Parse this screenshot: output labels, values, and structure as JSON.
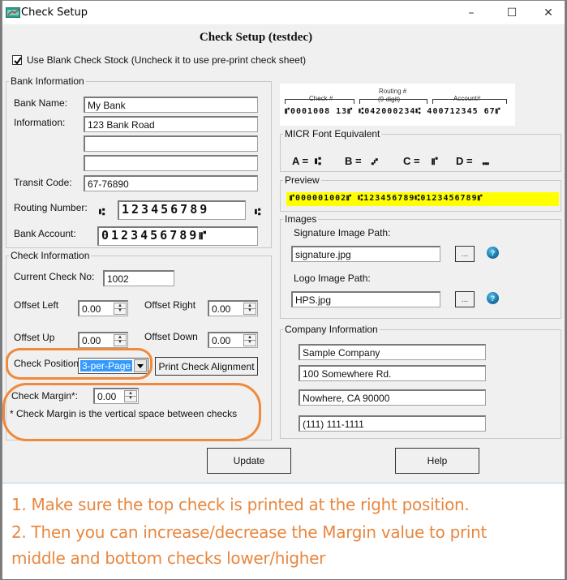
{
  "window": {
    "title": "Check Setup",
    "controls": {
      "minimize": "–",
      "maximize": "☐",
      "close": "✕"
    }
  },
  "heading": "Check Setup (testdec)",
  "blank_check_stock": {
    "label": "Use Blank Check Stock (Uncheck it to use pre-print check sheet)",
    "checked": true
  },
  "bank_information": {
    "legend": "Bank Information",
    "bank_name_label": "Bank Name:",
    "bank_name": "My Bank",
    "information_label": "Information:",
    "information_line1": "123 Bank Road",
    "information_line2": "",
    "information_line3": "",
    "transit_code_label": "Transit Code:",
    "transit_code": "67-76890",
    "routing_number_label": "Routing Number:",
    "routing_number": "123456789",
    "routing_symbol": "⑆",
    "bank_account_label": "Bank Account:",
    "bank_account": "0123456789⑈"
  },
  "check_information": {
    "legend": "Check Information",
    "current_check_label": "Current Check No:",
    "current_check_no": "1002",
    "offset_left_label": "Offset Left",
    "offset_left": "0.00",
    "offset_right_label": "Offset Right",
    "offset_right": "0.00",
    "offset_up_label": "Offset Up",
    "offset_up": "0.00",
    "offset_down_label": "Offset Down",
    "offset_down": "0.00",
    "check_position_label": "Check Position",
    "check_position": "3-per-Page",
    "print_alignment_button": "Print Check Alignment",
    "check_margin_label": "Check Margin*:",
    "check_margin": "0.00",
    "check_margin_note": "* Check Margin is the vertical space between checks"
  },
  "check_diagram": {
    "check_label": "Check #",
    "routing_label": "Routing #",
    "routing_sublabel": "(9-digit)",
    "account_label": "Account#",
    "micr_line": "⑈0001008 13⑈ ⑆042000234⑆ 400712345 67⑈"
  },
  "micr_font": {
    "legend": "MICR Font Equivalent",
    "items": [
      {
        "key": "A =",
        "symbol": "⑆"
      },
      {
        "key": "B =",
        "symbol": "⑇"
      },
      {
        "key": "C =",
        "symbol": "⑈"
      },
      {
        "key": "D =",
        "symbol": "⑉"
      }
    ]
  },
  "preview": {
    "legend": "Preview",
    "micr_line": "⑈000001002⑈ ⑆123456789⑆0123456789⑈",
    "highlight_color": "#ffff00"
  },
  "images": {
    "legend": "Images",
    "signature_label": "Signature Image Path:",
    "signature_path": "signature.jpg",
    "logo_label": "Logo Image Path:",
    "logo_path": "HPS.jpg",
    "browse_label": "...",
    "help_glyph": "?"
  },
  "company_information": {
    "legend": "Company Information",
    "name": "Sample Company",
    "address1": "100 Somewhere Rd.",
    "address2": "Nowhere, CA 90000",
    "phone": "(111) 111-1111"
  },
  "buttons": {
    "update": "Update",
    "help": "Help"
  },
  "instructions": {
    "line1": "1. Make sure the top check is printed at the right position.",
    "line2": "2. Then you can increase/decrease the Margin value to print",
    "line3": "middle and bottom checks lower/higher",
    "color": "#e8873f"
  },
  "annotation_color": "#f0893b"
}
